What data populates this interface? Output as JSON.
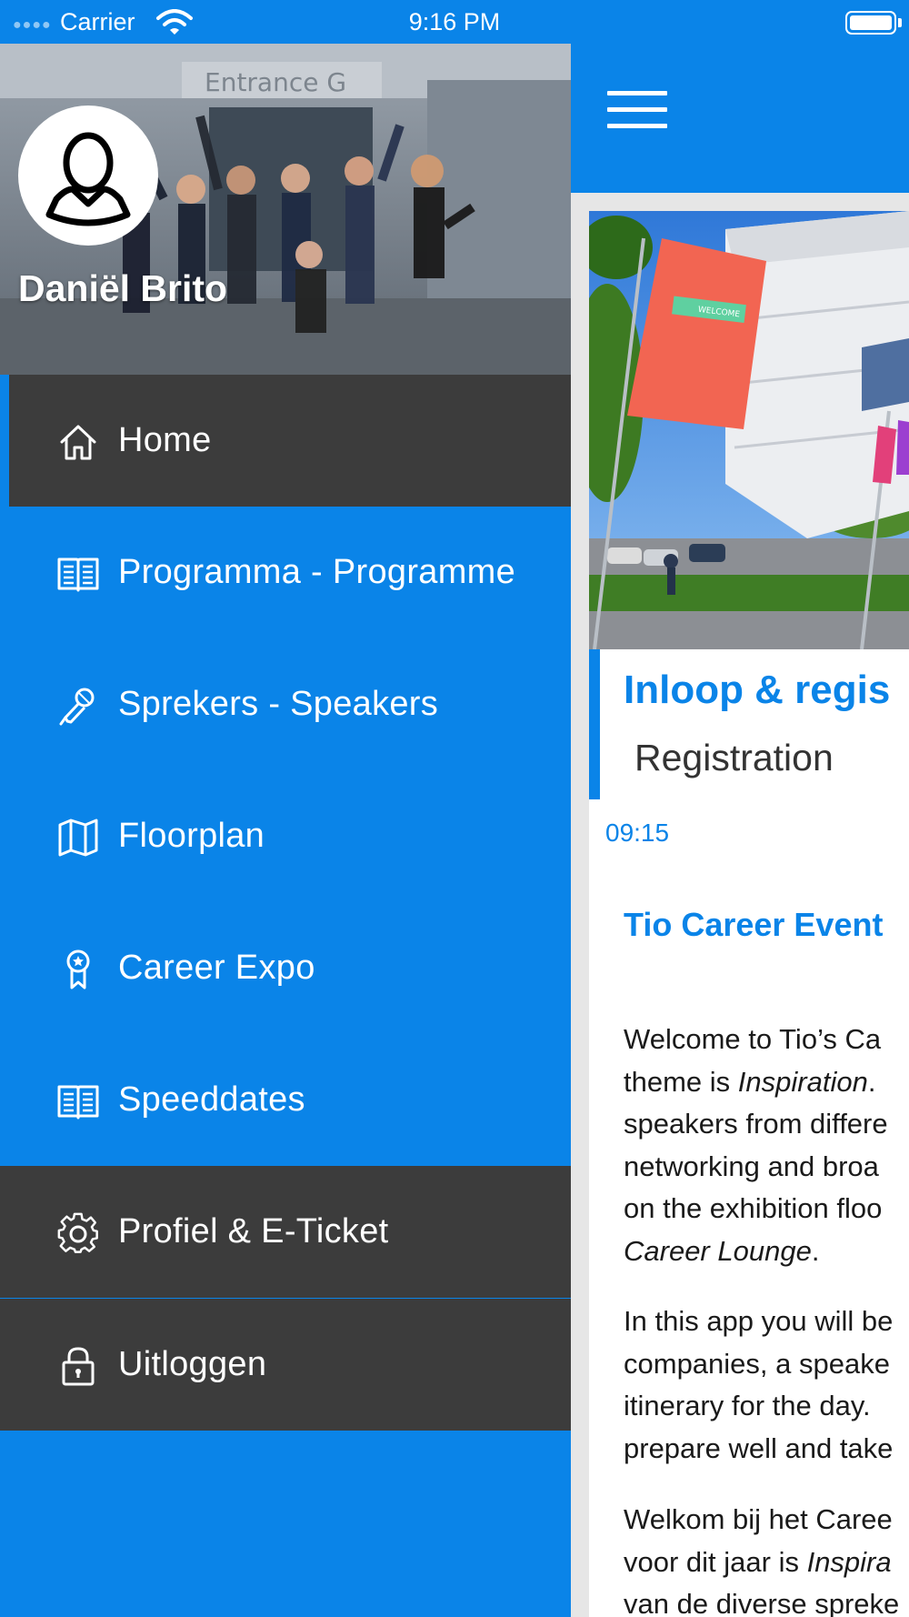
{
  "status_bar": {
    "carrier": "Carrier",
    "time": "9:16 PM"
  },
  "drawer": {
    "user_name": "Daniël Brito",
    "header_sign_text": "Entrance G",
    "items": [
      {
        "label": "Home",
        "icon": "home-icon",
        "state": "selected"
      },
      {
        "label": "Programma - Programme",
        "icon": "book-icon"
      },
      {
        "label": "Sprekers - Speakers",
        "icon": "microphone-icon"
      },
      {
        "label": "Floorplan",
        "icon": "map-icon"
      },
      {
        "label": "Career Expo",
        "icon": "award-ribbon-icon"
      },
      {
        "label": "Speeddates",
        "icon": "book-icon"
      },
      {
        "label": "Profiel & E-Ticket",
        "icon": "gear-icon"
      },
      {
        "label": "Uitloggen",
        "icon": "lock-icon"
      }
    ]
  },
  "main": {
    "hero_banner_text": "WELCOME",
    "session": {
      "title": "Inloop & regis",
      "subtitle": "Registration",
      "time": "09:15"
    },
    "event_title": "Tio Career Event",
    "paragraphs": [
      {
        "lines": [
          "Welcome to Tio’s Ca",
          "theme is Inspiration.",
          "speakers from differe",
          "networking and broa",
          "on the exhibition floo",
          "Career Lounge."
        ]
      },
      {
        "lines": [
          "In this app you will be",
          "companies, a speake",
          "itinerary for the day.",
          "prepare well and take"
        ]
      },
      {
        "lines": [
          "Welkom bij het Caree",
          "voor dit jaar is Inspira",
          "van de diverse spreke"
        ]
      }
    ]
  },
  "colors": {
    "brand_blue": "#0a84e8",
    "menu_dark": "#3c3c3c"
  }
}
